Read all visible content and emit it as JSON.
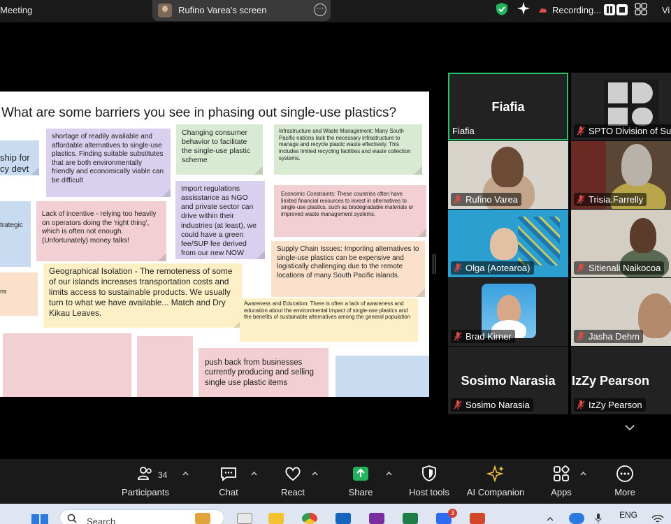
{
  "topbar": {
    "app_title": "Meeting",
    "share_label": "Rufino Varea's screen",
    "recording_label": "Recording...",
    "view_label": "Vi",
    "colors": {
      "shield": "#22b35c",
      "recording": "#e04b4b"
    }
  },
  "slide": {
    "title": "What are some barriers you see in phasing out single-use plastics?",
    "notes": [
      {
        "id": "partial-1",
        "color": "blue",
        "text": "ship for\ncy devt"
      },
      {
        "id": "shortage",
        "color": "purple",
        "text": "shortage of readily available and affordable alternatives to single-use plastics. Finding suitable substitutes that are both environmentally friendly and economically viable can be difficult"
      },
      {
        "id": "consumer",
        "color": "green",
        "text": "Changing consumer behavior to facilitate the single-use plastic scheme"
      },
      {
        "id": "infrastructure",
        "color": "green",
        "text": "Infrastructure and Waste Management: Many South Pacific nations lack the necessary infrastructure to manage and recycle plastic waste effectively. This includes limited recycling facilities and waste collection systems."
      },
      {
        "id": "partial-2",
        "color": "blue",
        "text": "trategic"
      },
      {
        "id": "incentive",
        "color": "pink",
        "text": "Lack of incentive - relying too heavily on operators doing the 'right thing', which is often not enough. (Unfortunately) money talks!"
      },
      {
        "id": "import",
        "color": "purple",
        "text": "Import regulations assisstance as NGO and private sector can drive within their industries (at least), we could have a green fee/SUP fee derived from our new NOW Trust fund as well."
      },
      {
        "id": "economic",
        "color": "pink",
        "text": "Economic Constraints: These countries often have limited financial resources to invest in alternatives to single-use plastics, such as biodegradable materials or improved waste management systems."
      },
      {
        "id": "supply",
        "color": "orange",
        "text": "Supply Chain Issues: Importing alternatives to single-use plastics can be expensive and logistically challenging due to the remote locations of many South Pacific islands."
      },
      {
        "id": "partial-3",
        "color": "orange",
        "text": "ns"
      },
      {
        "id": "geo",
        "color": "yellow",
        "text": "Geographical Isolation - The remoteness of some of our islands increases transportation costs and limits access to sustainable products. We usually turn to what we have available... Match and Dry Kikau Leaves."
      },
      {
        "id": "awareness",
        "color": "yellow",
        "text": "Awareness and Education: There is often a lack of awareness and education about the environmental impact of single-use plastics and the benefits of sustainable alternatives among the general population"
      },
      {
        "id": "pushback",
        "color": "pink",
        "text": "push back from businesses currently producing and selling single use plastic items"
      }
    ]
  },
  "gallery": {
    "participants": [
      {
        "name": "Fiafia",
        "big_name": "Fiafia",
        "active": true
      },
      {
        "name": "SPTO Division of Su"
      },
      {
        "name": "Rufino Varea"
      },
      {
        "name": "Trisia.Farrelly"
      },
      {
        "name": "Olga (Aotearoa)"
      },
      {
        "name": "Sitienali Naikocoa"
      },
      {
        "name": "Brad Kirner"
      },
      {
        "name": "Jasha Dehm"
      },
      {
        "name": "Sosimo Narasia",
        "big_name": "Sosimo Narasia"
      },
      {
        "name": "IzZy Pearson",
        "big_name": "IzZy Pearson"
      }
    ]
  },
  "toolbar": {
    "participants_count": "34",
    "items": [
      {
        "label": "Participants",
        "icon": "participants-icon"
      },
      {
        "label": "Chat",
        "icon": "chat-icon"
      },
      {
        "label": "React",
        "icon": "heart-icon"
      },
      {
        "label": "Share",
        "icon": "share-icon"
      },
      {
        "label": "Host tools",
        "icon": "shield-icon"
      },
      {
        "label": "AI Companion",
        "icon": "sparkle-icon"
      },
      {
        "label": "Apps",
        "icon": "apps-icon"
      },
      {
        "label": "More",
        "icon": "more-icon"
      }
    ],
    "colors": {
      "share": "#22b35c",
      "ai": "#f5c542"
    }
  },
  "taskbar": {
    "search_placeholder": "Search",
    "language": "ENG",
    "zoom_badge": "3"
  }
}
